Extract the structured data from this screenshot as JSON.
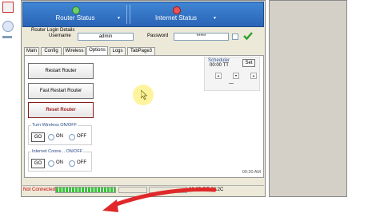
{
  "header": {
    "router_status_label": "Router Status",
    "internet_status_label": "Internet Status",
    "router_status_color": "#4caf50",
    "internet_status_color": "#e53935"
  },
  "login": {
    "group_title": "Router Login Details",
    "username_label": "Username",
    "username_value": "admin",
    "password_label": "Password",
    "password_value": "*****",
    "confirm_icon": "check-icon"
  },
  "tabs": [
    "Main",
    "Config",
    "Wireless",
    "Options",
    "Logs",
    "TabPage3"
  ],
  "active_tab": "Options",
  "options": {
    "restart_router": "Restart Router",
    "fast_restart_router": "Fast Restart Router",
    "reset_router": "Reset Router",
    "wireless_group": "Turn Wireless ON/OFF",
    "internet_group": "Internet Conne... ON/OFF",
    "go_label": "GO",
    "on_label": "ON",
    "off_label": "OFF"
  },
  "scheduler": {
    "title": "Scheduler",
    "time": "00:00 TT",
    "set_label": "Set",
    "dash": "—"
  },
  "panel_clock": "00:30 AM",
  "status": {
    "connection": "Not Connected",
    "mac": "00:0D:DF:28:2C",
    "connection_color": "#cc0000",
    "progress_color": "#3cc23c"
  },
  "annotation": {
    "arrow_color": "#e0282a"
  }
}
